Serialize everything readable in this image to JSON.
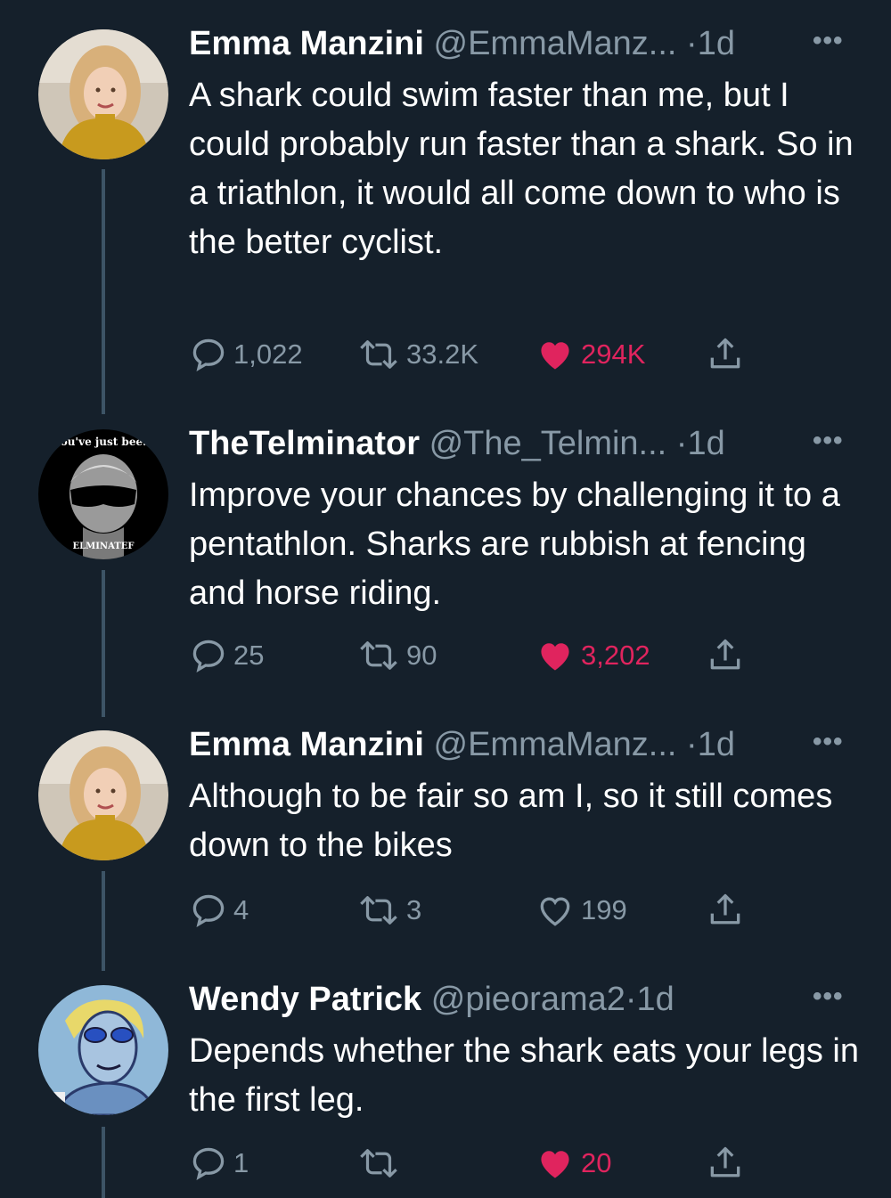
{
  "colors": {
    "background": "#15202b",
    "text": "#ffffff",
    "muted": "#8899a6",
    "like": "#e0245e",
    "thread_line": "#3d5466"
  },
  "tweets": [
    {
      "name": "Emma Manzini",
      "handle": "@EmmaManz...",
      "dot": "·",
      "time": "1d",
      "more": "•••",
      "text": "A shark could swim faster than me, but I could probably run faster than a shark. So in a triathlon, it would all come down to who is the better cyclist.",
      "replies": "1,022",
      "retweets": "33.2K",
      "likes": "294K",
      "liked": true
    },
    {
      "name": "TheTelminator",
      "handle": "@The_Telmin...",
      "dot": "·",
      "time": "1d",
      "more": "•••",
      "avatar_text_top": "ou've just bee.",
      "avatar_text_bottom": "ELMINATEF",
      "text": "Improve your chances by challenging it to a pentathlon. Sharks are rubbish at fencing and horse riding.",
      "replies": "25",
      "retweets": "90",
      "likes": "3,202",
      "liked": true
    },
    {
      "name": "Emma Manzini",
      "handle": "@EmmaManz...",
      "dot": "·",
      "time": "1d",
      "more": "•••",
      "text": "Although to be fair so am I, so it still comes down to the bikes",
      "replies": "4",
      "retweets": "3",
      "likes": "199",
      "liked": false
    },
    {
      "name": "Wendy Patrick",
      "handle": "@pieorama2",
      "dot": "·",
      "time": "1d",
      "more": "•••",
      "text": "Depends whether the shark eats your legs in the first leg.",
      "replies": "1",
      "retweets": "",
      "likes": "20",
      "liked": true
    }
  ]
}
